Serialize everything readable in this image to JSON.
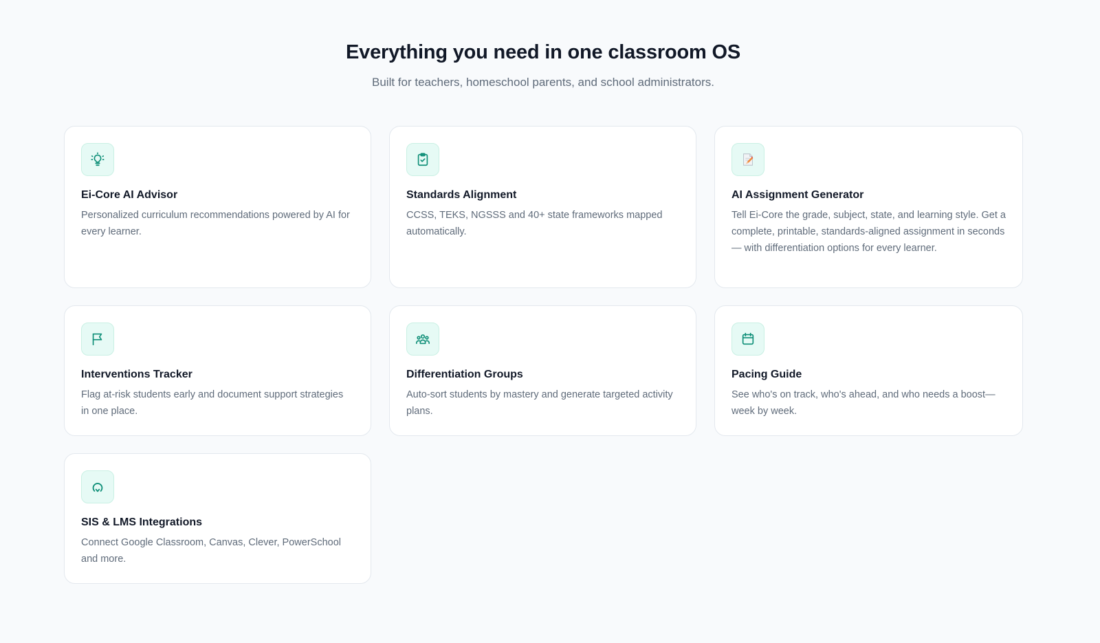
{
  "section": {
    "title": "Everything you need in one classroom OS",
    "subtitle": "Built for teachers, homeschool parents, and school administrators."
  },
  "features": [
    {
      "icon": "lightbulb-icon",
      "title": "Ei-Core AI Advisor",
      "description": "Personalized curriculum recommendations powered by AI for every learner."
    },
    {
      "icon": "clipboard-check-icon",
      "title": "Standards Alignment",
      "description": "CCSS, TEKS, NGSSS and 40+ state frameworks mapped automatically."
    },
    {
      "icon": "document-pencil-icon",
      "title": "AI Assignment Generator",
      "description": "Tell Ei-Core the grade, subject, state, and learning style. Get a complete, printable, standards-aligned assignment in seconds — with differentiation options for every learner."
    },
    {
      "icon": "flag-icon",
      "title": "Interventions Tracker",
      "description": "Flag at-risk students early and document support strategies in one place."
    },
    {
      "icon": "users-group-icon",
      "title": "Differentiation Groups",
      "description": "Auto-sort students by mastery and generate targeted activity plans."
    },
    {
      "icon": "calendar-icon",
      "title": "Pacing Guide",
      "description": "See who's on track, who's ahead, and who needs a boost—week by week."
    },
    {
      "icon": "integration-link-icon",
      "title": "SIS & LMS Integrations",
      "description": "Connect Google Classroom, Canvas, Clever, PowerSchool and more."
    }
  ],
  "colors": {
    "accent": "#0f9f86",
    "icon_bg": "#e6faf5",
    "card_border": "#e3e8ee",
    "page_bg": "#f8fafc"
  }
}
